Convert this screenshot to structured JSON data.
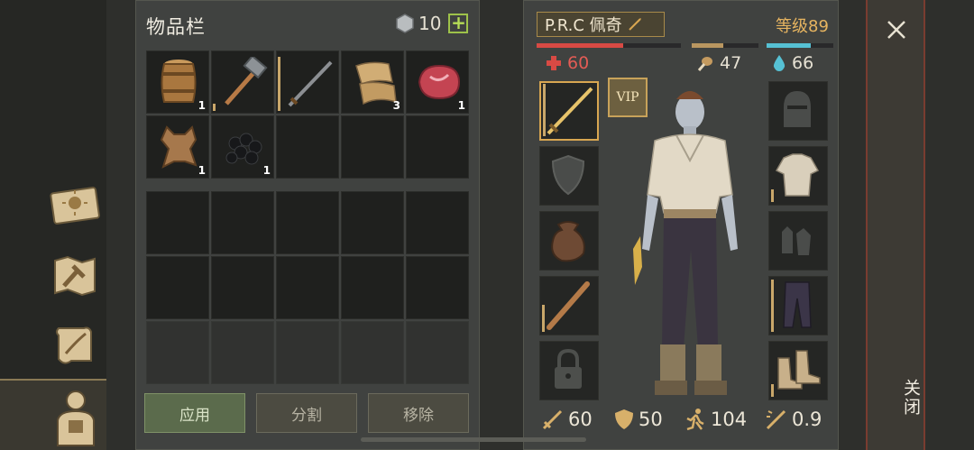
{
  "inventory": {
    "title": "物品栏",
    "coins": "10",
    "add_label": "+",
    "items": [
      {
        "icon": "barrel-icon",
        "count": "1"
      },
      {
        "icon": "hammer-icon",
        "count": ""
      },
      {
        "icon": "sword-icon",
        "count": ""
      },
      {
        "icon": "cloth-icon",
        "count": "3"
      },
      {
        "icon": "meat-icon",
        "count": "1"
      },
      {
        "icon": "leather-hide-icon",
        "count": "1"
      },
      {
        "icon": "coal-icon",
        "count": "1"
      }
    ],
    "buttons": {
      "apply": "应用",
      "split": "分割",
      "remove": "移除"
    }
  },
  "character": {
    "name": "P.R.C 佩奇",
    "level": "等级89",
    "vip": "VIP",
    "health": "60",
    "food": "47",
    "water": "66",
    "health_fill": 0.6,
    "food_fill": 0.47,
    "water_fill": 0.66,
    "attack": "60",
    "defense": "50",
    "speed": "104",
    "attack_speed": "0.9"
  },
  "close": {
    "label": "关闭"
  },
  "colors": {
    "health": "#d84a44",
    "food": "#b99660",
    "water": "#56c1d4",
    "accent": "#d8a651"
  }
}
